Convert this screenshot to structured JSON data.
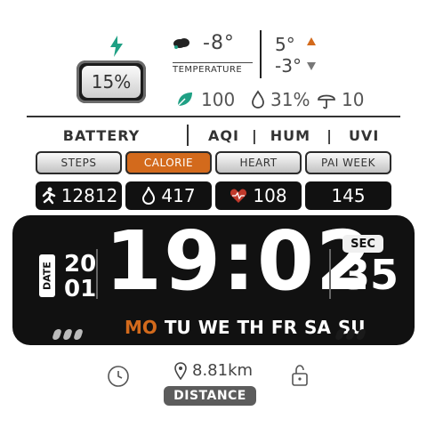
{
  "weather": {
    "current_temp": "-8°",
    "label": "TEMPERATURE",
    "max_temp": "5°",
    "min_temp": "-3°"
  },
  "battery": {
    "percent": "15%",
    "label": "BATTERY"
  },
  "environment": {
    "aqi_value": "100",
    "humidity_value": "31%",
    "uvi_value": "10",
    "headers": [
      "AQI",
      "HUM",
      "UVI"
    ],
    "separator": "|"
  },
  "activity": {
    "tabs": [
      "STEPS",
      "CALORIE",
      "HEART",
      "PAI WEEK"
    ],
    "active_tab": "CALORIE",
    "values": [
      "12812",
      "417",
      "108",
      "145"
    ]
  },
  "clock": {
    "time": "19:02",
    "seconds": "35",
    "seconds_label": "SEC",
    "date_label": "DATE",
    "day": "20",
    "month": "01"
  },
  "weekdays": {
    "items": [
      "MO",
      "TU",
      "WE",
      "TH",
      "FR",
      "SA",
      "SU"
    ],
    "active": "MO"
  },
  "distance": {
    "value": "8.81km",
    "label": "DISTANCE"
  },
  "colors": {
    "accent": "#d36a1c",
    "panel": "#111111"
  }
}
